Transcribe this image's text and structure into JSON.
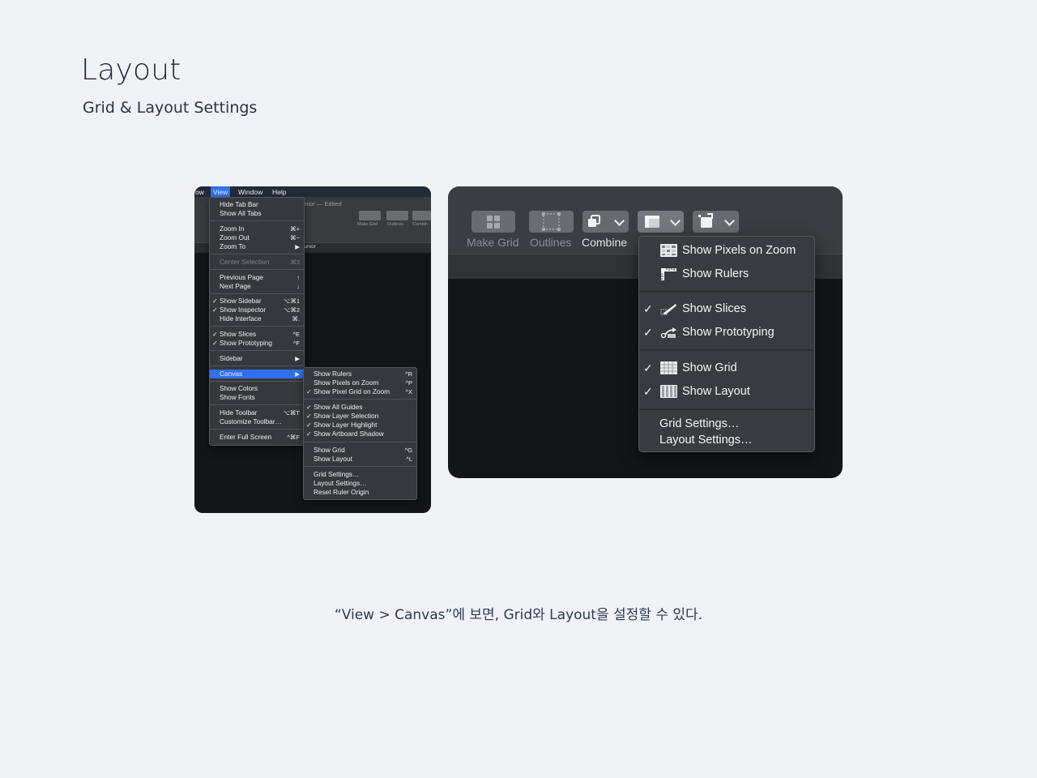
{
  "page": {
    "title": "Layout",
    "subtitle": "Grid & Layout Settings",
    "caption": "“View > Canvas”에 보면, Grid와 Layout을 설정할 수 있다."
  },
  "left_shot": {
    "menubar": [
      "ow",
      "View",
      "Window",
      "Help"
    ],
    "window_title": "unior — Edited",
    "toolbar_labels": [
      "Make Grid",
      "Outlines",
      "Combin"
    ],
    "tab_label": "junior",
    "view_menu": [
      {
        "label": "Hide Tab Bar",
        "shortcut": ""
      },
      {
        "label": "Show All Tabs",
        "shortcut": ""
      },
      {
        "label": "Zoom In",
        "shortcut": "⌘+"
      },
      {
        "label": "Zoom Out",
        "shortcut": "⌘−"
      },
      {
        "label": "Zoom To",
        "shortcut": "▶"
      },
      {
        "label": "Center Selection",
        "shortcut": "⌘3"
      },
      {
        "label": "Previous Page",
        "shortcut": "↑"
      },
      {
        "label": "Next Page",
        "shortcut": "↓"
      },
      {
        "label": "Show Sidebar",
        "shortcut": "⌥⌘1",
        "check": "✓"
      },
      {
        "label": "Show Inspector",
        "shortcut": "⌥⌘2",
        "check": "✓"
      },
      {
        "label": "Hide Interface",
        "shortcut": "⌘."
      },
      {
        "label": "Show Slices",
        "shortcut": "^E",
        "check": "✓"
      },
      {
        "label": "Show Prototyping",
        "shortcut": "^F",
        "check": "✓"
      },
      {
        "label": "Sidebar",
        "shortcut": "▶"
      },
      {
        "label": "Canvas",
        "shortcut": "▶"
      },
      {
        "label": "Show Colors",
        "shortcut": ""
      },
      {
        "label": "Show Fonts",
        "shortcut": ""
      },
      {
        "label": "Hide Toolbar",
        "shortcut": "⌥⌘T"
      },
      {
        "label": "Customize Toolbar…",
        "shortcut": ""
      },
      {
        "label": "Enter Full Screen",
        "shortcut": "^⌘F"
      }
    ],
    "canvas_menu": [
      {
        "label": "Show Rulers",
        "shortcut": "^R"
      },
      {
        "label": "Show Pixels on Zoom",
        "shortcut": "^P"
      },
      {
        "label": "Show Pixel Grid on Zoom",
        "shortcut": "^X",
        "check": "✓"
      },
      {
        "label": "Show All Guides",
        "shortcut": "",
        "check": "✓"
      },
      {
        "label": "Show Layer Selection",
        "shortcut": "",
        "check": "✓"
      },
      {
        "label": "Show Layer Highlight",
        "shortcut": "",
        "check": "✓"
      },
      {
        "label": "Show Artboard Shadow",
        "shortcut": "",
        "check": "✓"
      },
      {
        "label": "Show Grid",
        "shortcut": "^G"
      },
      {
        "label": "Show Layout",
        "shortcut": "^L"
      },
      {
        "label": "Grid Settings…",
        "shortcut": ""
      },
      {
        "label": "Layout Settings…",
        "shortcut": ""
      },
      {
        "label": "Reset Ruler Origin",
        "shortcut": ""
      }
    ]
  },
  "right_shot": {
    "toolbar": {
      "make_grid": "Make Grid",
      "outlines": "Outlines",
      "combine": "Combine"
    },
    "menu": {
      "show_pixels_on_zoom": "Show Pixels on Zoom",
      "show_rulers": "Show Rulers",
      "show_slices": "Show Slices",
      "show_prototyping": "Show Prototyping",
      "show_grid": "Show Grid",
      "show_layout": "Show Layout",
      "grid_settings": "Grid Settings…",
      "layout_settings": "Layout Settings…",
      "check": "✓"
    }
  }
}
